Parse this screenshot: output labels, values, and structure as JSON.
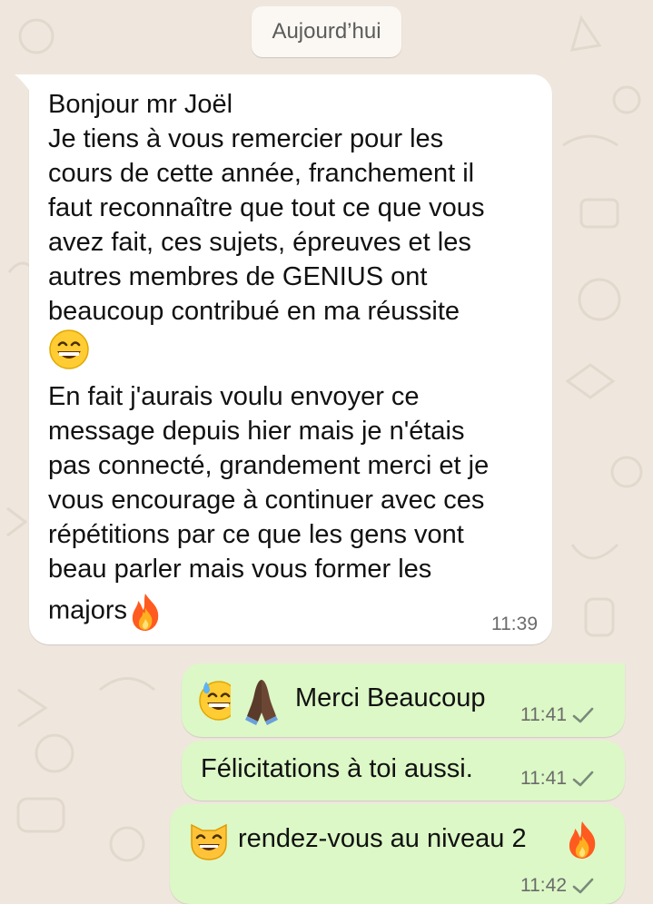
{
  "date_separator": "Aujourd’hui",
  "messages": [
    {
      "direction": "incoming",
      "line1": "Bonjour mr Joël",
      "line2": "Je tiens à vous remercier pour les",
      "line3": "cours de cette année, franchement il",
      "line4": "faut reconnaître que tout ce que vous",
      "line5": "avez fait, ces sujets, épreuves et les",
      "line6": "autres membres de GENIUS ont",
      "line7": "beaucoup contribué en ma réussite",
      "line8": "En fait j'aurais voulu envoyer ce",
      "line9": "message depuis hier mais je n'étais",
      "line10": "pas connecté, grandement merci et je",
      "line11": "vous encourage à continuer avec ces",
      "line12": "répétitions par ce que les gens vont",
      "line13": "beau parler mais vous former les",
      "line14": "majors",
      "time": "11:39",
      "emojis": [
        "grinning-face-icon",
        "fire-icon"
      ]
    },
    {
      "direction": "outgoing",
      "text": "Merci Beaucoup",
      "time": "11:41",
      "emojis": [
        "grinning-sweat-icon",
        "folded-hands-icon"
      ],
      "status": "sent-check-icon"
    },
    {
      "direction": "outgoing",
      "text": "Félicitations à toi aussi.",
      "time": "11:41",
      "status": "sent-check-icon"
    },
    {
      "direction": "outgoing",
      "text": "rendez-vous au niveau 2",
      "time": "11:42",
      "emojis": [
        "grinning-cat-icon",
        "fire-icon"
      ],
      "status": "sent-check-icon"
    }
  ],
  "colors": {
    "background": "#efe7de",
    "incoming_bubble": "#ffffff",
    "outgoing_bubble": "#dcf8c6",
    "timestamp": "#6b6b6b"
  }
}
